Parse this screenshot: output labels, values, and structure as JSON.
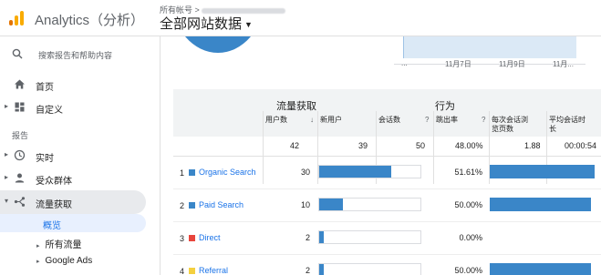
{
  "header": {
    "app_title": "Analytics（分析）",
    "account_crumb": "所有帐号 >",
    "view_name": "全部网站数据",
    "view_caret": "▼"
  },
  "sidebar": {
    "search_placeholder": "搜索报告和帮助内容",
    "items": [
      {
        "label": "首页",
        "icon": "home-icon"
      },
      {
        "label": "自定义",
        "icon": "dashboard-icon"
      }
    ],
    "section_label": "报告",
    "report_items": [
      {
        "label": "实时",
        "icon": "clock-icon"
      },
      {
        "label": "受众群体",
        "icon": "person-icon"
      },
      {
        "label": "流量获取",
        "icon": "acquisition-icon"
      }
    ],
    "sub_items": [
      {
        "label": "概览"
      },
      {
        "label": "所有流量"
      },
      {
        "label": "Google Ads"
      }
    ]
  },
  "chart": {
    "ticks": [
      "...",
      "11月7日",
      "11月9日",
      "11月..."
    ]
  },
  "table": {
    "group_acquisition": "流量获取",
    "group_behavior": "行为",
    "columns": {
      "users": "用户数",
      "new_users": "新用户",
      "sessions": "会话数",
      "bounce_rate": "跳出率",
      "pages_per_session_1": "每次会话浏",
      "pages_per_session_2": "览页数",
      "avg_duration_1": "平均会话时",
      "avg_duration_2": "长"
    },
    "sort_icon": "↓",
    "help_icon": "?",
    "totals": {
      "users": "42",
      "new_users": "39",
      "sessions": "50",
      "bounce_rate": "48.00%",
      "pages_per_session": "1.88",
      "avg_duration": "00:00:54"
    },
    "rows": [
      {
        "index": "1",
        "name": "Organic Search",
        "color": "#3a86c8",
        "users": "30",
        "users_share": 0.714,
        "bounce_rate": "51.61%",
        "bounce_share": 0.94
      },
      {
        "index": "2",
        "name": "Paid Search",
        "color": "#3a86c8",
        "users": "10",
        "users_share": 0.238,
        "bounce_rate": "50.00%",
        "bounce_share": 0.91
      },
      {
        "index": "3",
        "name": "Direct",
        "color": "#e8453c",
        "users": "2",
        "users_share": 0.048,
        "bounce_rate": "0.00%",
        "bounce_share": 0.0
      },
      {
        "index": "4",
        "name": "Referral",
        "color": "#f4d03f",
        "users": "2",
        "users_share": 0.048,
        "bounce_rate": "50.00%",
        "bounce_share": 0.91
      }
    ]
  }
}
